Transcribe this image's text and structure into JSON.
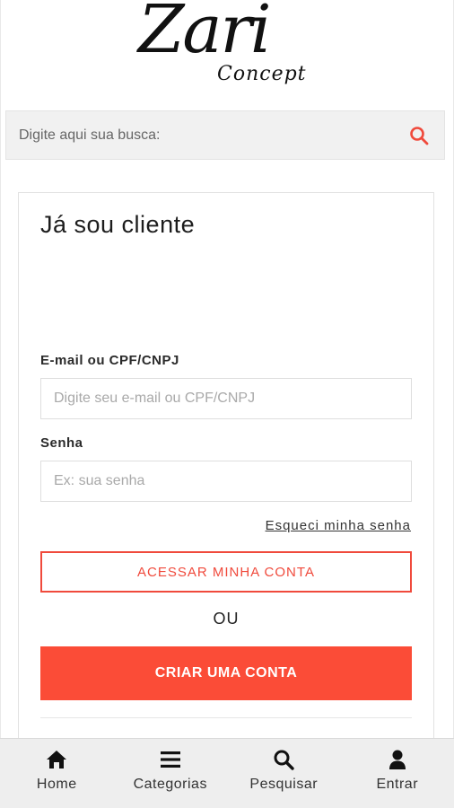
{
  "brand": {
    "name_main": "Zari",
    "name_sub": "Concept"
  },
  "search": {
    "placeholder": "Digite aqui sua busca:"
  },
  "login": {
    "title": "Já sou cliente",
    "email_label": "E-mail ou CPF/CNPJ",
    "email_placeholder": "Digite seu e-mail ou CPF/CNPJ",
    "email_value": "",
    "password_label": "Senha",
    "password_placeholder": "Ex: sua senha",
    "password_value": "",
    "forgot_label": "Esqueci minha senha",
    "access_label": "ACESSAR MINHA CONTA",
    "or_label": "OU",
    "create_label": "CRIAR UMA CONTA"
  },
  "bottom_nav": [
    {
      "label": "Home",
      "icon": "home-icon"
    },
    {
      "label": "Categorias",
      "icon": "menu-icon"
    },
    {
      "label": "Pesquisar",
      "icon": "search-icon"
    },
    {
      "label": "Entrar",
      "icon": "user-icon"
    }
  ],
  "colors": {
    "accent": "#fb4c37",
    "outline_accent": "#f04a3c",
    "search_icon": "#f04a3c"
  }
}
